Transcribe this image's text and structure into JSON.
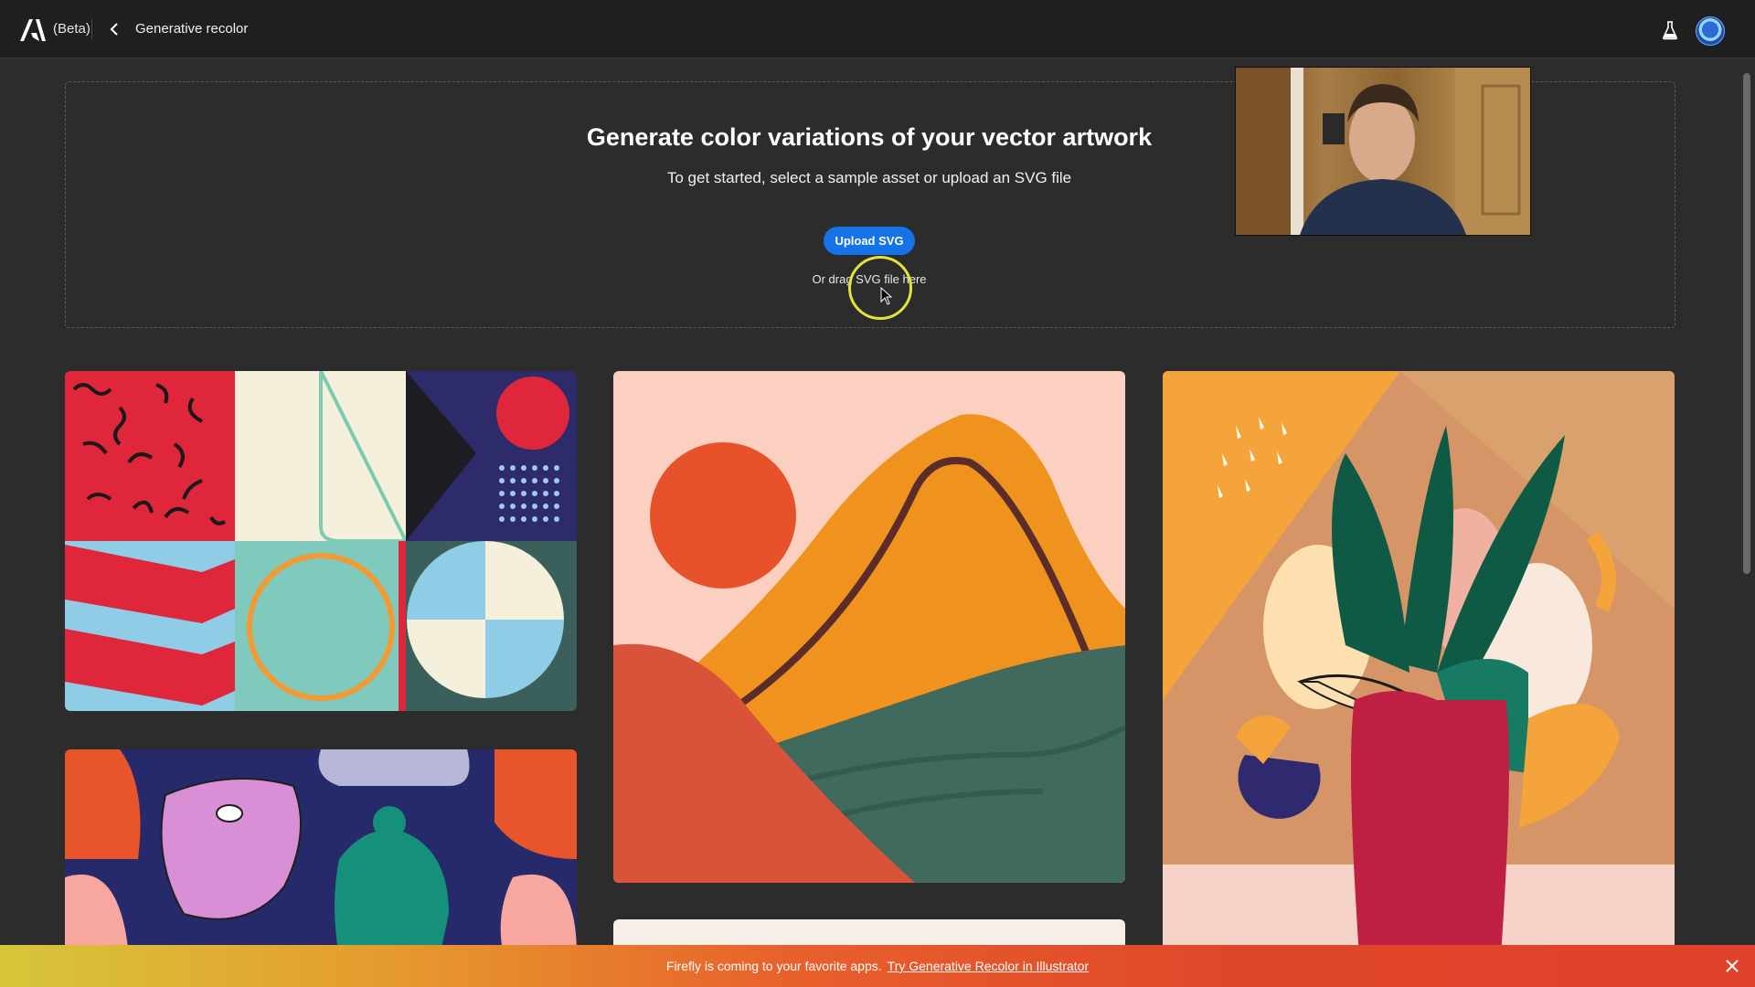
{
  "app": {
    "beta_label": "(Beta)",
    "page_title": "Generative recolor"
  },
  "dropzone": {
    "headline": "Generate color variations of your vector artwork",
    "subtitle": "To get started, select a sample asset or upload an SVG file",
    "upload_button": "Upload SVG",
    "drag_text": "Or drag SVG file here"
  },
  "icons": {
    "logo": "adobe-logo-icon",
    "back": "chevron-left-icon",
    "labs": "flask-icon",
    "close": "close-icon"
  },
  "gallery": [
    {
      "name": "geometric-patterns"
    },
    {
      "name": "landscape-sunset"
    },
    {
      "name": "plant-vase"
    },
    {
      "name": "figures-pattern"
    },
    {
      "name": "partial-sample"
    }
  ],
  "banner": {
    "text": "Firefly is coming to your favorite apps.",
    "link": "Try Generative Recolor in Illustrator"
  },
  "colors": {
    "accent": "#1473e6",
    "background": "#2c2c2c",
    "topbar": "#1f1f1f"
  }
}
